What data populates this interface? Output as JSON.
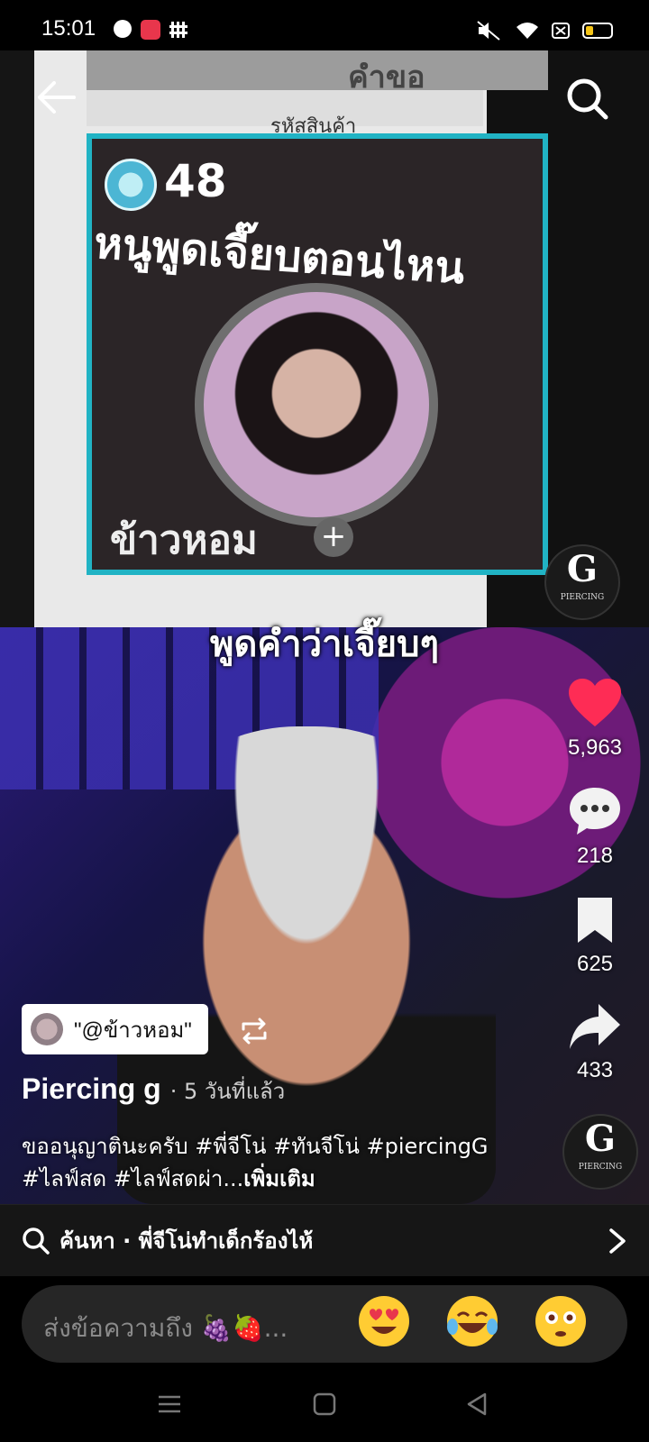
{
  "status_bar": {
    "time": "15:01",
    "icons": [
      "zalo-icon",
      "recorder-icon",
      "grid-app-icon",
      "mute-icon",
      "wifi-icon",
      "sim-icon",
      "battery-icon"
    ],
    "battery_level": 0.3,
    "battery_color": "#f5c518"
  },
  "nav": {
    "back_icon": "arrow-left-icon",
    "search_icon": "search-icon"
  },
  "video": {
    "top_clip": {
      "doc_heading": "คำขอ",
      "doc_subheading": "รหัสสินค้า",
      "gift_count": "48",
      "caption": "หนูพูดเจี๊ยบตอนไหน",
      "profile_name": "ข้าวหอม",
      "plus": "+"
    },
    "overlay_caption": "พูดคำว่าเจี๊ยบๆ",
    "watermark": {
      "letter": "G",
      "text": "PIERCING"
    }
  },
  "actions": {
    "likes": "5,963",
    "comments": "218",
    "saves": "625",
    "shares": "433",
    "like_color": "#fe2c55"
  },
  "remix": {
    "label": "\"@ข้าวหอม\""
  },
  "author": {
    "name": "Piercing g",
    "time": "· 5 วันที่แล้ว"
  },
  "description": {
    "text": "ขออนุญาตินะครับ #พี่จีโน่ #ทันจีโน่ #piercingG #ไลฟ์สด #ไลฟ์สดผ่า...",
    "more": "เพิ่มเติม"
  },
  "search_suggestion": {
    "text": "ค้นหา · พี่จีโน่ทำเด็กร้องไห้"
  },
  "composer": {
    "placeholder": "ส่งข้อความถึง 🍇🍓...",
    "emojis": [
      "heart-eyes-emoji",
      "laughing-tears-emoji",
      "flushed-emoji"
    ]
  },
  "system_nav": [
    "menu-icon",
    "home-icon",
    "back-triangle-icon"
  ]
}
